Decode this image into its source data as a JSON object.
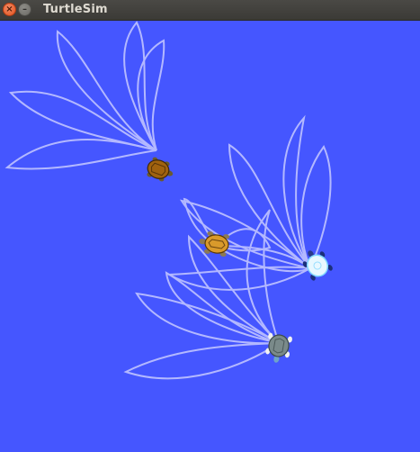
{
  "window": {
    "title": "TurtleSim",
    "close_glyph": "×",
    "minimize_glyph": "–"
  },
  "canvas": {
    "background_color": "#4556ff",
    "pen_color": "#b3b8ff"
  },
  "turtles": [
    {
      "name": "turtle-brown",
      "shell": "#a0620f"
    },
    {
      "name": "turtle-orange",
      "shell": "#d99a2b"
    },
    {
      "name": "turtle-cyan",
      "shell": "#e8f8ff"
    },
    {
      "name": "turtle-gray",
      "shell": "#7a8a8a"
    }
  ]
}
